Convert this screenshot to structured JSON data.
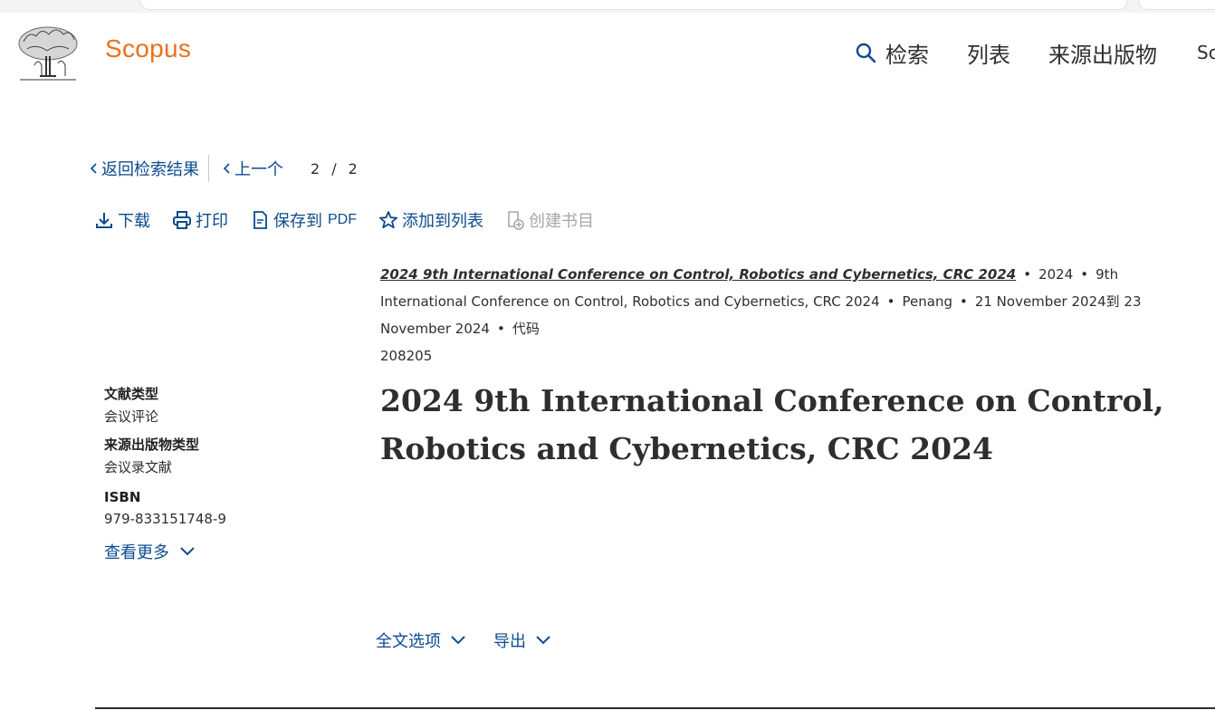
{
  "header": {
    "brand": "Scopus",
    "nav": {
      "search": "检索",
      "lists": "列表",
      "sources": "来源出版物",
      "more": "Sc"
    }
  },
  "navigation": {
    "back_label": "返回检索结果",
    "prev_label": "上一个",
    "current": "2",
    "slash": "/",
    "total": "2"
  },
  "toolbar": {
    "download": "下载",
    "print": "打印",
    "save_pdf": "保存到",
    "save_pdf_suffix": "PDF",
    "add_to_list": "添加到列表",
    "create_bib": "创建书目"
  },
  "source": {
    "title": "2024 9th International Conference on Control, Robotics and Cybernetics, CRC 2024",
    "year": "2024",
    "conference": "9th International Conference on Control, Robotics and Cybernetics, CRC 2024",
    "location": "Penang",
    "dates": "21 November 2024到 23 November 2024",
    "code_label": "代码",
    "code": "208205"
  },
  "sidebar": {
    "doc_type_label": "文献类型",
    "doc_type": "会议评论",
    "source_type_label": "来源出版物类型",
    "source_type": "会议录文献",
    "isbn_label": "ISBN",
    "isbn": "979-833151748-9",
    "show_more": "查看更多"
  },
  "document": {
    "title": "2024 9th International Conference on Control, Robotics and Cybernetics, CRC 2024"
  },
  "actions": {
    "full_text": "全文选项",
    "export": "导出"
  },
  "colors": {
    "link": "#0c4b8e",
    "brand": "#e9711c",
    "text": "#2e2e2e",
    "disabled": "#a6a6a6"
  }
}
